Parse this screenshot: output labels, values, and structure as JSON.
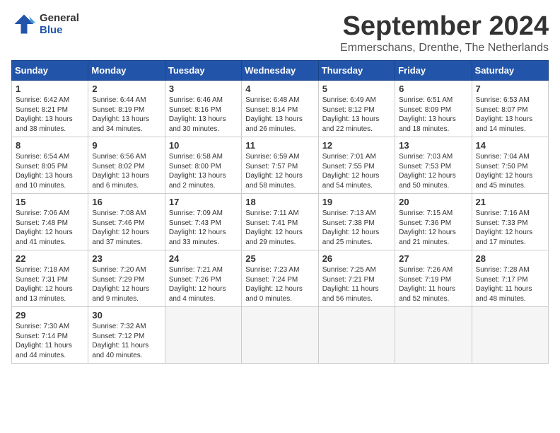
{
  "header": {
    "logo_line1": "General",
    "logo_line2": "Blue",
    "month": "September 2024",
    "location": "Emmerschans, Drenthe, The Netherlands"
  },
  "weekdays": [
    "Sunday",
    "Monday",
    "Tuesday",
    "Wednesday",
    "Thursday",
    "Friday",
    "Saturday"
  ],
  "weeks": [
    [
      {
        "day": "1",
        "lines": [
          "Sunrise: 6:42 AM",
          "Sunset: 8:21 PM",
          "Daylight: 13 hours",
          "and 38 minutes."
        ]
      },
      {
        "day": "2",
        "lines": [
          "Sunrise: 6:44 AM",
          "Sunset: 8:19 PM",
          "Daylight: 13 hours",
          "and 34 minutes."
        ]
      },
      {
        "day": "3",
        "lines": [
          "Sunrise: 6:46 AM",
          "Sunset: 8:16 PM",
          "Daylight: 13 hours",
          "and 30 minutes."
        ]
      },
      {
        "day": "4",
        "lines": [
          "Sunrise: 6:48 AM",
          "Sunset: 8:14 PM",
          "Daylight: 13 hours",
          "and 26 minutes."
        ]
      },
      {
        "day": "5",
        "lines": [
          "Sunrise: 6:49 AM",
          "Sunset: 8:12 PM",
          "Daylight: 13 hours",
          "and 22 minutes."
        ]
      },
      {
        "day": "6",
        "lines": [
          "Sunrise: 6:51 AM",
          "Sunset: 8:09 PM",
          "Daylight: 13 hours",
          "and 18 minutes."
        ]
      },
      {
        "day": "7",
        "lines": [
          "Sunrise: 6:53 AM",
          "Sunset: 8:07 PM",
          "Daylight: 13 hours",
          "and 14 minutes."
        ]
      }
    ],
    [
      {
        "day": "8",
        "lines": [
          "Sunrise: 6:54 AM",
          "Sunset: 8:05 PM",
          "Daylight: 13 hours",
          "and 10 minutes."
        ]
      },
      {
        "day": "9",
        "lines": [
          "Sunrise: 6:56 AM",
          "Sunset: 8:02 PM",
          "Daylight: 13 hours",
          "and 6 minutes."
        ]
      },
      {
        "day": "10",
        "lines": [
          "Sunrise: 6:58 AM",
          "Sunset: 8:00 PM",
          "Daylight: 13 hours",
          "and 2 minutes."
        ]
      },
      {
        "day": "11",
        "lines": [
          "Sunrise: 6:59 AM",
          "Sunset: 7:57 PM",
          "Daylight: 12 hours",
          "and 58 minutes."
        ]
      },
      {
        "day": "12",
        "lines": [
          "Sunrise: 7:01 AM",
          "Sunset: 7:55 PM",
          "Daylight: 12 hours",
          "and 54 minutes."
        ]
      },
      {
        "day": "13",
        "lines": [
          "Sunrise: 7:03 AM",
          "Sunset: 7:53 PM",
          "Daylight: 12 hours",
          "and 50 minutes."
        ]
      },
      {
        "day": "14",
        "lines": [
          "Sunrise: 7:04 AM",
          "Sunset: 7:50 PM",
          "Daylight: 12 hours",
          "and 45 minutes."
        ]
      }
    ],
    [
      {
        "day": "15",
        "lines": [
          "Sunrise: 7:06 AM",
          "Sunset: 7:48 PM",
          "Daylight: 12 hours",
          "and 41 minutes."
        ]
      },
      {
        "day": "16",
        "lines": [
          "Sunrise: 7:08 AM",
          "Sunset: 7:46 PM",
          "Daylight: 12 hours",
          "and 37 minutes."
        ]
      },
      {
        "day": "17",
        "lines": [
          "Sunrise: 7:09 AM",
          "Sunset: 7:43 PM",
          "Daylight: 12 hours",
          "and 33 minutes."
        ]
      },
      {
        "day": "18",
        "lines": [
          "Sunrise: 7:11 AM",
          "Sunset: 7:41 PM",
          "Daylight: 12 hours",
          "and 29 minutes."
        ]
      },
      {
        "day": "19",
        "lines": [
          "Sunrise: 7:13 AM",
          "Sunset: 7:38 PM",
          "Daylight: 12 hours",
          "and 25 minutes."
        ]
      },
      {
        "day": "20",
        "lines": [
          "Sunrise: 7:15 AM",
          "Sunset: 7:36 PM",
          "Daylight: 12 hours",
          "and 21 minutes."
        ]
      },
      {
        "day": "21",
        "lines": [
          "Sunrise: 7:16 AM",
          "Sunset: 7:33 PM",
          "Daylight: 12 hours",
          "and 17 minutes."
        ]
      }
    ],
    [
      {
        "day": "22",
        "lines": [
          "Sunrise: 7:18 AM",
          "Sunset: 7:31 PM",
          "Daylight: 12 hours",
          "and 13 minutes."
        ]
      },
      {
        "day": "23",
        "lines": [
          "Sunrise: 7:20 AM",
          "Sunset: 7:29 PM",
          "Daylight: 12 hours",
          "and 9 minutes."
        ]
      },
      {
        "day": "24",
        "lines": [
          "Sunrise: 7:21 AM",
          "Sunset: 7:26 PM",
          "Daylight: 12 hours",
          "and 4 minutes."
        ]
      },
      {
        "day": "25",
        "lines": [
          "Sunrise: 7:23 AM",
          "Sunset: 7:24 PM",
          "Daylight: 12 hours",
          "and 0 minutes."
        ]
      },
      {
        "day": "26",
        "lines": [
          "Sunrise: 7:25 AM",
          "Sunset: 7:21 PM",
          "Daylight: 11 hours",
          "and 56 minutes."
        ]
      },
      {
        "day": "27",
        "lines": [
          "Sunrise: 7:26 AM",
          "Sunset: 7:19 PM",
          "Daylight: 11 hours",
          "and 52 minutes."
        ]
      },
      {
        "day": "28",
        "lines": [
          "Sunrise: 7:28 AM",
          "Sunset: 7:17 PM",
          "Daylight: 11 hours",
          "and 48 minutes."
        ]
      }
    ],
    [
      {
        "day": "29",
        "lines": [
          "Sunrise: 7:30 AM",
          "Sunset: 7:14 PM",
          "Daylight: 11 hours",
          "and 44 minutes."
        ]
      },
      {
        "day": "30",
        "lines": [
          "Sunrise: 7:32 AM",
          "Sunset: 7:12 PM",
          "Daylight: 11 hours",
          "and 40 minutes."
        ]
      },
      {
        "day": "",
        "lines": []
      },
      {
        "day": "",
        "lines": []
      },
      {
        "day": "",
        "lines": []
      },
      {
        "day": "",
        "lines": []
      },
      {
        "day": "",
        "lines": []
      }
    ]
  ]
}
